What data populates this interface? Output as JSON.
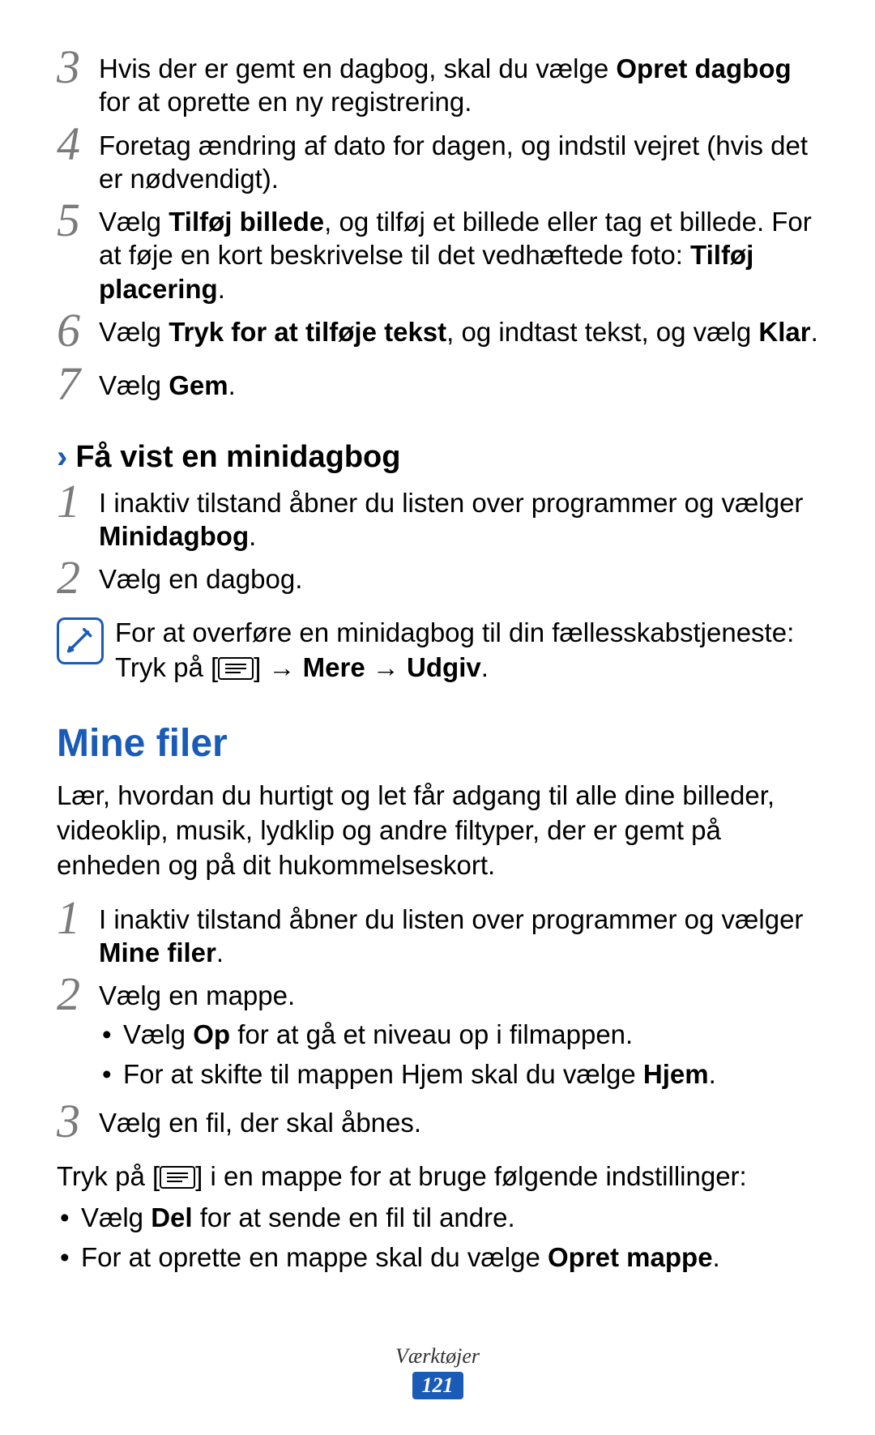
{
  "steps_a": [
    {
      "num": "3",
      "pre": "Hvis der er gemt en dagbog, skal du vælge ",
      "bold1": "Opret dagbog",
      "post": " for at oprette en ny registrering."
    },
    {
      "num": "4",
      "text": "Foretag ændring af dato for dagen, og indstil vejret (hvis det er nødvendigt)."
    },
    {
      "num": "5",
      "pre": "Vælg ",
      "bold1": "Tilføj billede",
      "mid": ", og tilføj et billede eller tag et billede. For at føje en kort beskrivelse til det vedhæftede foto: ",
      "bold2": "Tilføj placering",
      "post": "."
    },
    {
      "num": "6",
      "pre": "Vælg ",
      "bold1": "Tryk for at tilføje tekst",
      "mid": ", og indtast tekst, og vælg ",
      "bold2": "Klar",
      "post": "."
    },
    {
      "num": "7",
      "pre": "Vælg ",
      "bold1": "Gem",
      "post": "."
    }
  ],
  "subhead1": "Få vist en minidagbog",
  "steps_b": [
    {
      "num": "1",
      "pre": "I inaktiv tilstand åbner du listen over programmer og vælger ",
      "bold1": "Minidagbog",
      "post": "."
    },
    {
      "num": "2",
      "text": "Vælg en dagbog."
    }
  ],
  "note1": {
    "pre": "For at overføre en minidagbog til din fællesskabstjeneste: Tryk på [",
    "mid": "] → ",
    "bold1": "Mere",
    "mid2": " → ",
    "bold2": "Udgiv",
    "post": "."
  },
  "heading2": "Mine filer",
  "para1": "Lær, hvordan du hurtigt og let får adgang til alle dine billeder, videoklip, musik, lydklip og andre filtyper, der er gemt på enheden og på dit hukommelseskort.",
  "steps_c": [
    {
      "num": "1",
      "pre": "I inaktiv tilstand åbner du listen over programmer og vælger ",
      "bold1": "Mine filer",
      "post": "."
    },
    {
      "num": "2",
      "text": "Vælg en mappe."
    },
    {
      "num": "3",
      "text": "Vælg en fil, der skal åbnes."
    }
  ],
  "sub_bullets_c2": [
    {
      "pre": "Vælg ",
      "bold1": "Op",
      "post": " for at gå et niveau op i filmappen."
    },
    {
      "pre": "For at skifte til mappen Hjem skal du vælge ",
      "bold1": "Hjem",
      "post": "."
    }
  ],
  "intro_c": {
    "pre": "Tryk på [",
    "post": "] i en mappe for at bruge følgende indstillinger:"
  },
  "bullets_d": [
    {
      "pre": "Vælg ",
      "bold1": "Del",
      "post": " for at sende en fil til andre."
    },
    {
      "pre": "For at oprette en mappe skal du vælge ",
      "bold1": "Opret mappe",
      "post": "."
    }
  ],
  "footer": {
    "section": "Værktøjer",
    "page": "121"
  }
}
